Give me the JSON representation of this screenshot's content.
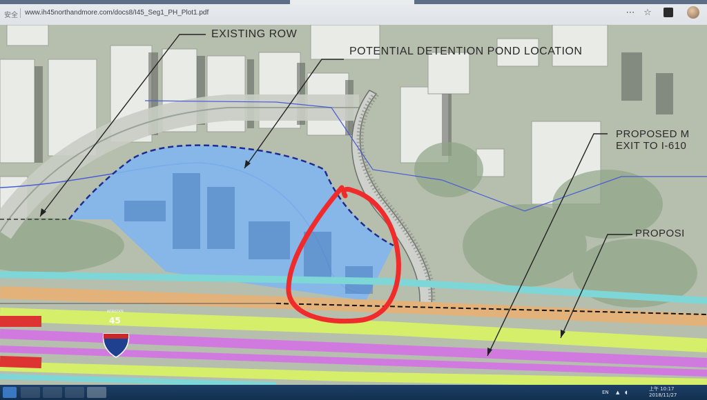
{
  "browser": {
    "security_label": "安全",
    "url": "www.ih45northandmore.com/docs8/I45_Seg1_PH_Plot1.pdf",
    "toolbar_icons": [
      "star-icon",
      "extension-icon",
      "profile-avatar"
    ]
  },
  "map": {
    "labels": {
      "existing_row": "EXISTING ROW",
      "detention_pond": "POTENTIAL DETENTION POND LOCATION",
      "proposed_exit_line1": "PROPOSED M",
      "proposed_exit_line2": "EXIT TO I-610",
      "proposed_short": "PROPOSI"
    },
    "shield": {
      "top_text": "INTERSTATE",
      "number": "45"
    },
    "colors": {
      "pond_fill": "#7fb6f0",
      "pond_border": "#1f2b8f",
      "red_circle": "#ef2b2b",
      "orange_lane": "#e2b27a",
      "green_lane": "#d6ef6a",
      "purple_lane": "#d07ae0",
      "teal_lane": "#7fd6d6",
      "shield_blue": "#1f3f8f",
      "shield_red": "#c8282a"
    }
  },
  "taskbar": {
    "input_indicator": "EN",
    "clock_time": "上午 10:17",
    "clock_date": "2018/11/27"
  }
}
